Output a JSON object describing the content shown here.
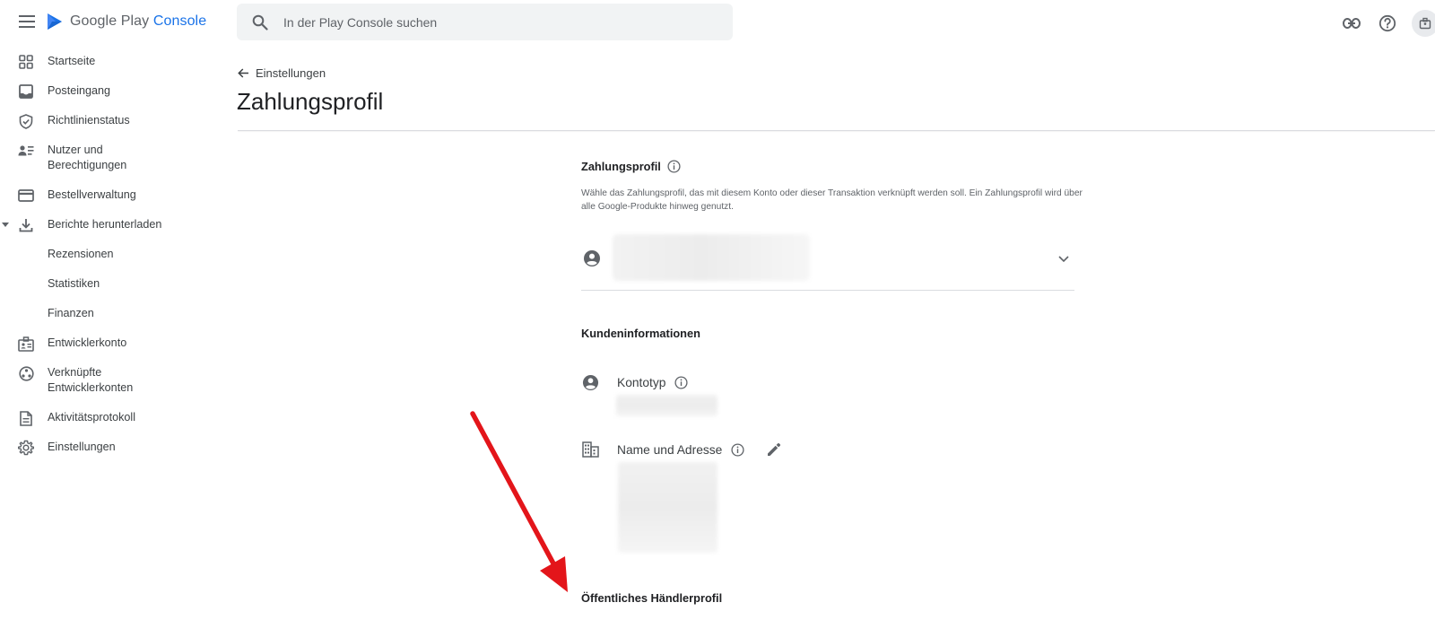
{
  "topbar": {
    "brand_prefix": "Google Play",
    "brand_accent": "Console",
    "search_placeholder": "In der Play Console suchen",
    "icons": [
      "menu-icon",
      "search-icon",
      "link-icon",
      "help-icon",
      "account-icon"
    ]
  },
  "sidebar": {
    "items": [
      {
        "label": "Startseite",
        "icon": "dashboard-icon"
      },
      {
        "label": "Posteingang",
        "icon": "inbox-icon"
      },
      {
        "label": "Richtlinienstatus",
        "icon": "shield-icon"
      },
      {
        "label": "Nutzer und\nBerechtigungen",
        "icon": "users-icon"
      },
      {
        "label": "Bestellverwaltung",
        "icon": "credit-card-icon"
      },
      {
        "label": "Berichte herunterladen",
        "icon": "download-icon",
        "expanded": true
      },
      {
        "label": "Rezensionen",
        "icon": ""
      },
      {
        "label": "Statistiken",
        "icon": ""
      },
      {
        "label": "Finanzen",
        "icon": ""
      },
      {
        "label": "Entwicklerkonto",
        "icon": "badge-icon"
      },
      {
        "label": "Verknüpfte\nEntwicklerkonten",
        "icon": "linked-accounts-icon"
      },
      {
        "label": "Aktivitätsprotokoll",
        "icon": "document-icon"
      },
      {
        "label": "Einstellungen",
        "icon": "gear-icon"
      }
    ]
  },
  "main": {
    "back_label": "Einstellungen",
    "title": "Zahlungsprofil",
    "payment_profile": {
      "heading": "Zahlungsprofil",
      "description": "Wähle das Zahlungsprofil, das mit diesem Konto oder dieser Transaktion verknüpft werden soll. Ein Zahlungsprofil wird über alle Google-Produkte hinweg genutzt."
    },
    "customer_info": {
      "heading": "Kundeninformationen",
      "account_type_label": "Kontotyp",
      "name_address_label": "Name und Adresse"
    },
    "merchant_profile": {
      "heading": "Öffentliches Händlerprofil"
    }
  },
  "colors": {
    "accent": "#1a73e8",
    "annotation_arrow": "#e3151a",
    "icon": "#5f6368"
  }
}
